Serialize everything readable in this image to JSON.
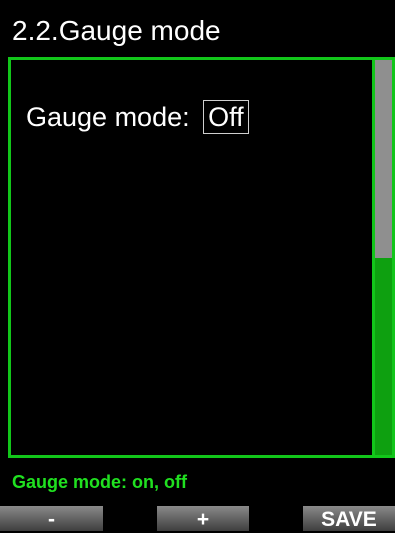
{
  "header": {
    "title": "2.2.Gauge mode"
  },
  "setting": {
    "label": "Gauge mode:",
    "value": "Off"
  },
  "scrollbar": {
    "thumb_color": "#8f8f8f",
    "track_color": "#0ea010"
  },
  "hint": {
    "text": "Gauge mode: on, off"
  },
  "softkeys": {
    "minus": "-",
    "plus": "+",
    "save": "SAVE"
  },
  "colors": {
    "accent": "#12c61a",
    "hint": "#20e020",
    "background": "#000000"
  }
}
